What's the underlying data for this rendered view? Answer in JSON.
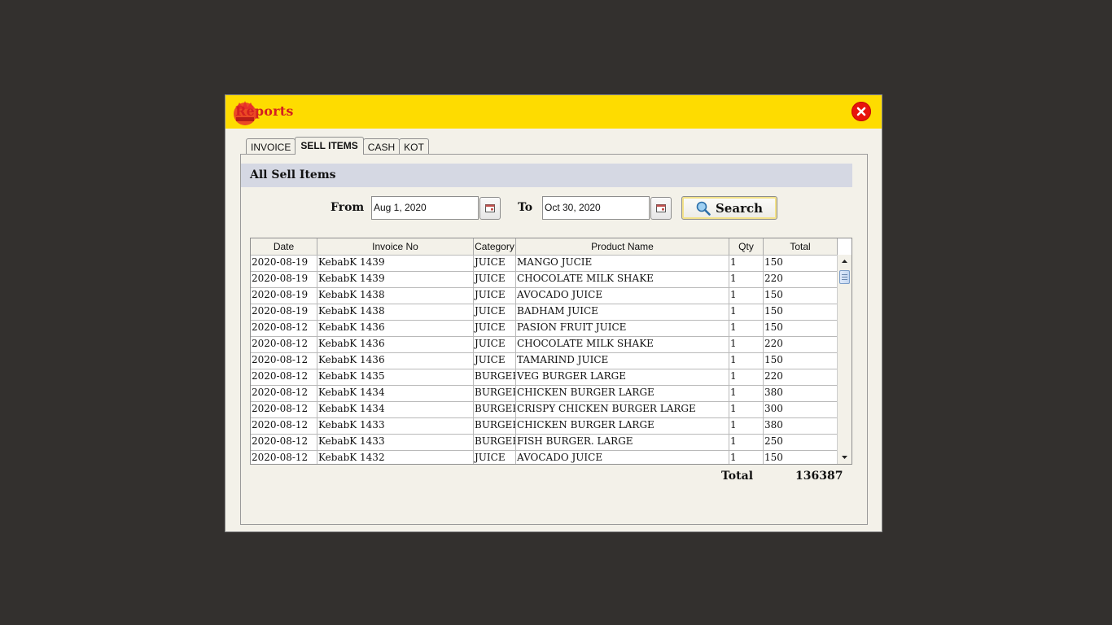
{
  "window": {
    "title": "Reports",
    "colors": {
      "titlebar": "#fedc00",
      "title_text": "#d42020",
      "close": "#e8140c"
    }
  },
  "tabs": [
    {
      "label": "INVOICE"
    },
    {
      "label": "SELL ITEMS",
      "active": true
    },
    {
      "label": "CASH"
    },
    {
      "label": "KOT"
    }
  ],
  "section": {
    "title": "All Sell Items"
  },
  "filter": {
    "from_label": "From",
    "from_value": "Aug 1, 2020",
    "to_label": "To",
    "to_value": "Oct 30, 2020",
    "search_label": "Search"
  },
  "table": {
    "columns": [
      "Date",
      "Invoice No",
      "Category",
      "Product Name",
      "Qty",
      "Total"
    ],
    "rows": [
      [
        "2020-08-19",
        "KebabK 1439",
        "JUICE",
        "MANGO JUCIE",
        "1",
        "150"
      ],
      [
        "2020-08-19",
        "KebabK 1439",
        "JUICE",
        "CHOCOLATE MILK SHAKE",
        "1",
        "220"
      ],
      [
        "2020-08-19",
        "KebabK 1438",
        "JUICE",
        "AVOCADO JUICE",
        "1",
        "150"
      ],
      [
        "2020-08-19",
        "KebabK 1438",
        "JUICE",
        "BADHAM JUICE",
        "1",
        "150"
      ],
      [
        "2020-08-12",
        "KebabK 1436",
        "JUICE",
        "PASION FRUIT JUICE",
        "1",
        "150"
      ],
      [
        "2020-08-12",
        "KebabK 1436",
        "JUICE",
        "CHOCOLATE MILK SHAKE",
        "1",
        "220"
      ],
      [
        "2020-08-12",
        "KebabK 1436",
        "JUICE",
        "TAMARIND JUICE",
        "1",
        "150"
      ],
      [
        "2020-08-12",
        "KebabK 1435",
        "BURGER",
        "VEG BURGER LARGE",
        "1",
        "220"
      ],
      [
        "2020-08-12",
        "KebabK 1434",
        "BURGER",
        "CHICKEN BURGER LARGE",
        "1",
        "380"
      ],
      [
        "2020-08-12",
        "KebabK 1434",
        "BURGER",
        "CRISPY CHICKEN BURGER LARGE",
        "1",
        "300"
      ],
      [
        "2020-08-12",
        "KebabK 1433",
        "BURGER",
        "CHICKEN BURGER LARGE",
        "1",
        "380"
      ],
      [
        "2020-08-12",
        "KebabK 1433",
        "BURGER",
        "FISH BURGER. LARGE",
        "1",
        "250"
      ],
      [
        "2020-08-12",
        "KebabK 1432",
        "JUICE",
        "AVOCADO JUICE",
        "1",
        "150"
      ]
    ]
  },
  "summary": {
    "total_label": "Total",
    "total_value": "136387"
  }
}
